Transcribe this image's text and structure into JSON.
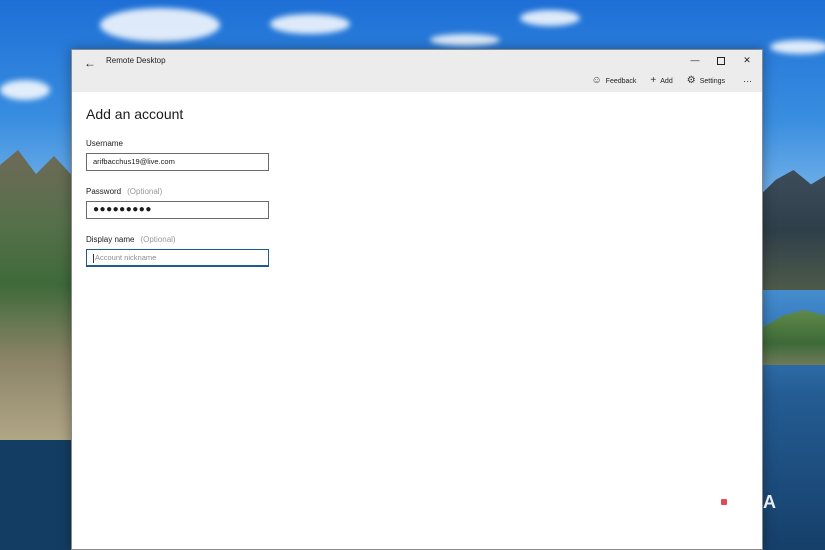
{
  "window": {
    "app_title": "Remote Desktop",
    "controls": {
      "minimize": "—",
      "close": "✕"
    }
  },
  "toolbar": {
    "feedback_label": "Feedback",
    "add_label": "Add",
    "settings_label": "Settings",
    "more_label": "···"
  },
  "icons": {
    "back": "arrow-left-icon",
    "feedback": "smiley-icon",
    "add": "plus-icon",
    "settings": "gear-icon",
    "more": "ellipsis-icon"
  },
  "form": {
    "heading": "Add an account",
    "username": {
      "label": "Username",
      "value": "arifbacchus19@live.com"
    },
    "password": {
      "label": "Password",
      "optional": "(Optional)",
      "value": "●●●●●●●●●"
    },
    "display_name": {
      "label": "Display name",
      "optional": "(Optional)",
      "placeholder": "Account nickname",
      "value": ""
    }
  },
  "watermark": {
    "text": "XDA"
  },
  "colors": {
    "window_bg": "#ffffff",
    "titlebar_bg": "#ececec",
    "focus_border": "#1f5b8f",
    "optional_text": "#9a9a9a"
  }
}
